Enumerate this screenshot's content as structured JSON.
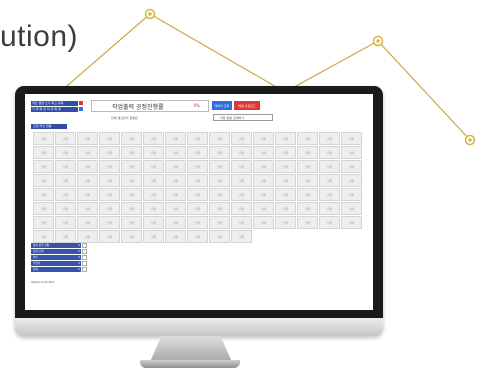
{
  "heading": {
    "text": "ution)"
  },
  "colors": {
    "accent": "#d7b53c",
    "line": "#cfa94a",
    "panel_blue": "#2f4fa7",
    "btn_blue": "#2d6fe0",
    "btn_red": "#e03636"
  },
  "screen": {
    "left_labels": [
      "개인 열정 쓰기 최고 과목",
      "기 과 목 관 리 과 목 정"
    ],
    "title": "작업출력 공정진행률",
    "status": "0%",
    "button_blue": "데이터 조회",
    "button_red": "엑셀 다운로드",
    "subtitle": "전체 생산관리 현황판",
    "search_hint": "작업 현황 검색하기",
    "section_label": "조립 라인 현황",
    "cell_text": "진행",
    "legend": [
      {
        "label": "생산 품목 현황",
        "value": "0"
      },
      {
        "label": "공정 단계",
        "value": "0"
      },
      {
        "label": "라인",
        "value": "0"
      },
      {
        "label": "작업자",
        "value": "0"
      },
      {
        "label": "합계",
        "value": "0"
      }
    ],
    "footer": "Status Indicator"
  }
}
